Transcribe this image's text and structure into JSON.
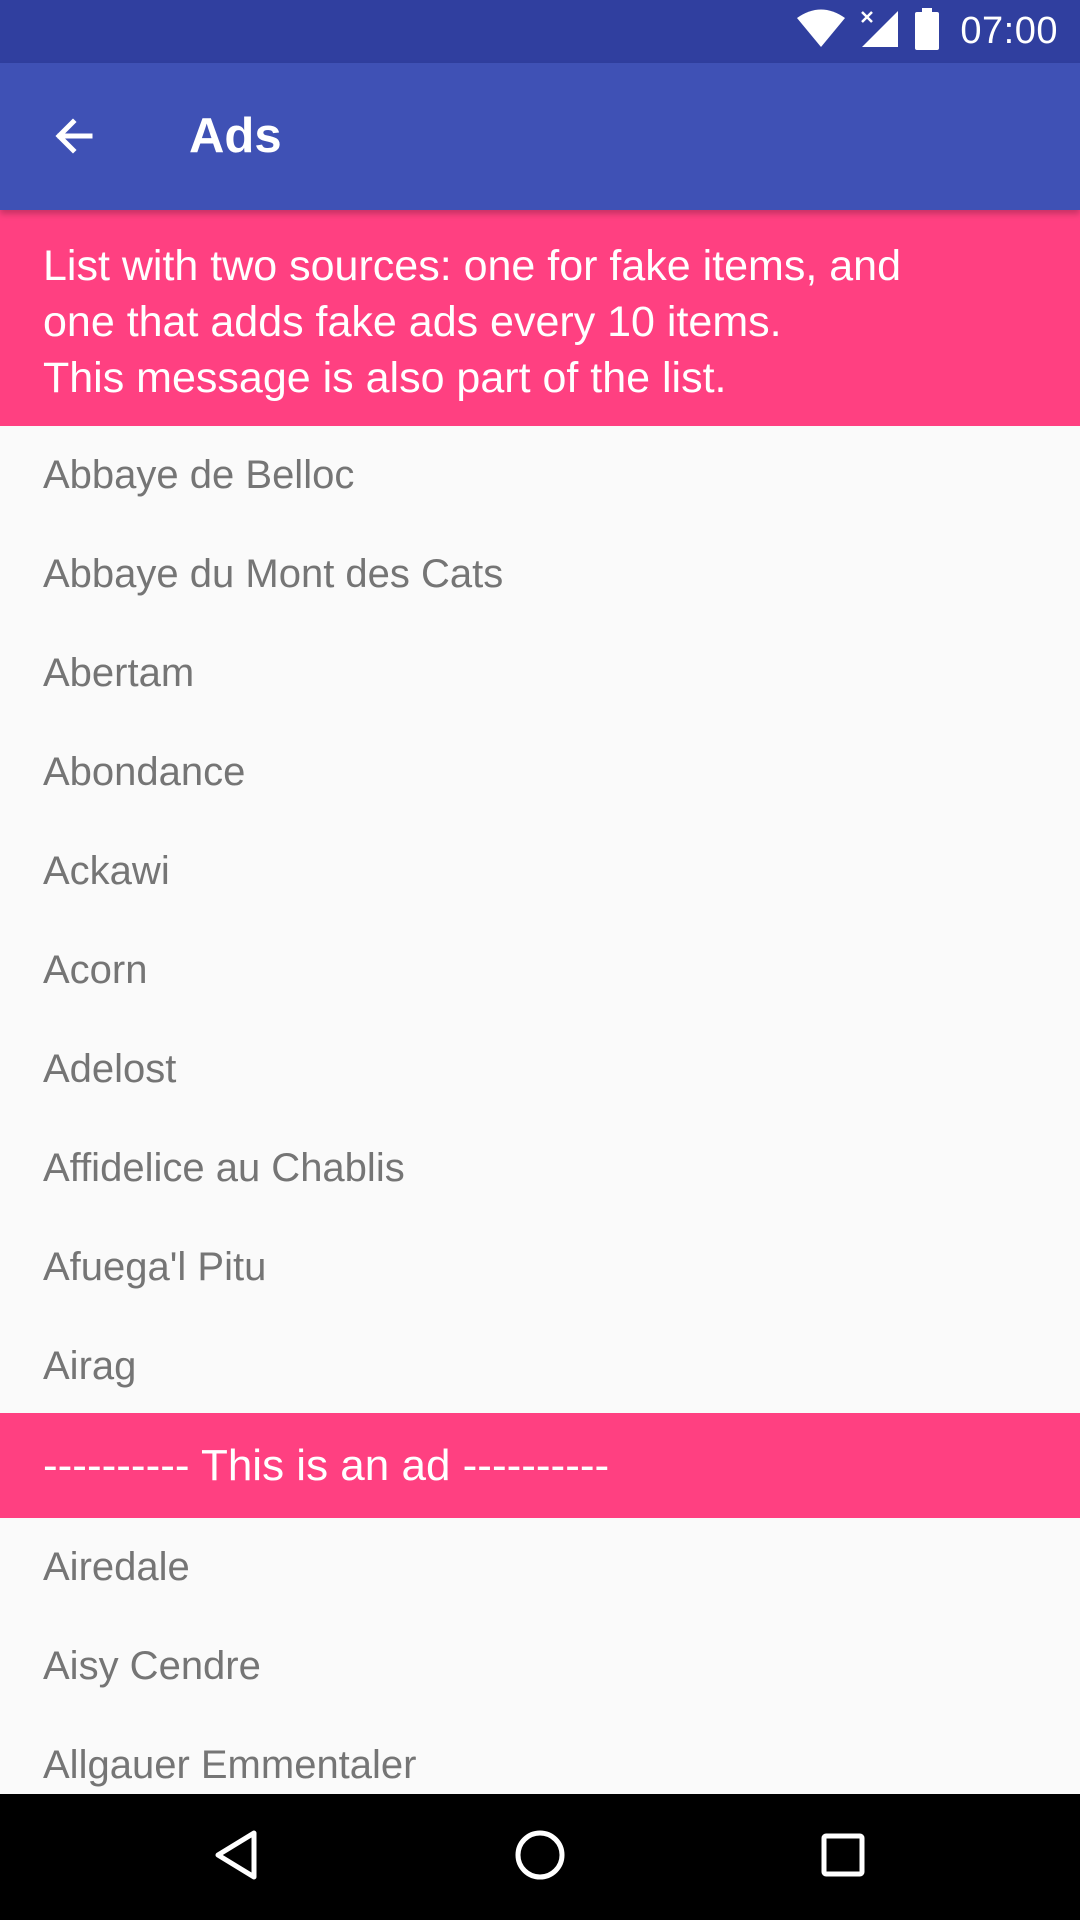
{
  "status_bar": {
    "time": "07:00",
    "icons": [
      "wifi-icon",
      "signal-icon",
      "battery-icon"
    ],
    "color": "#303f9f"
  },
  "toolbar": {
    "title": "Ads",
    "back_icon": "arrow-back-icon",
    "color": "#3f51b5"
  },
  "header_message": {
    "lines": [
      "List with two sources: one for fake items, and",
      "one that adds fake ads every 10 items.",
      "This message is also part of the list."
    ],
    "color": "#ff4081"
  },
  "items_before_ad": [
    "Abbaye de Belloc",
    "Abbaye du Mont des Cats",
    "Abertam",
    "Abondance",
    "Ackawi",
    "Acorn",
    "Adelost",
    "Affidelice au Chablis",
    "Afuega'l Pitu",
    "Airag"
  ],
  "ad": {
    "label": "---------- This is an ad ----------"
  },
  "items_after_ad": [
    "Airedale",
    "Aisy Cendre",
    "Allgauer Emmentaler"
  ],
  "nav_bar": {
    "buttons": [
      "back-triangle-icon",
      "home-circle-icon",
      "recents-square-icon"
    ]
  }
}
